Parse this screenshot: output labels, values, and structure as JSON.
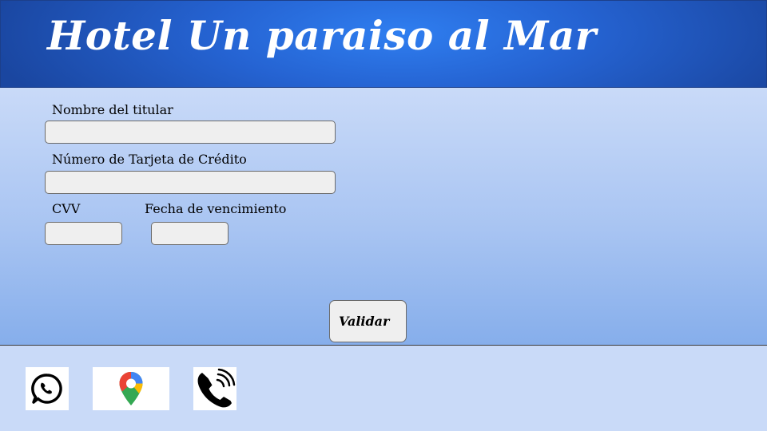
{
  "header": {
    "title": "Hotel Un paraiso al Mar"
  },
  "form": {
    "holder_label": "Nombre del titular",
    "holder_value": "",
    "card_label": "Número de Tarjeta de Crédito",
    "card_value": "",
    "cvv_label": "CVV",
    "cvv_value": "",
    "expiry_label": "Fecha de vencimiento",
    "expiry_value": "",
    "submit_label": "Validar"
  },
  "footer": {
    "icons": [
      "whatsapp-icon",
      "google-maps-icon",
      "phone-icon"
    ]
  },
  "colors": {
    "header_blue": "#2563d2",
    "background": "#c9daf8",
    "field_bg": "#efefef"
  }
}
